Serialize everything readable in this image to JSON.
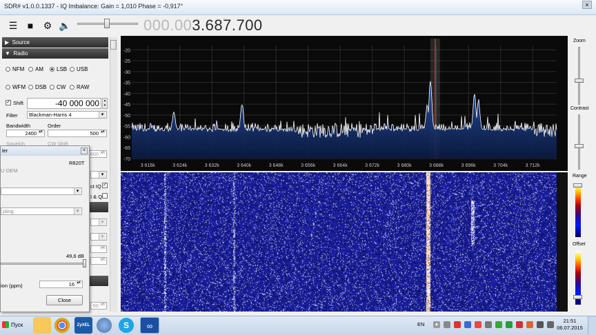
{
  "window": {
    "title": "SDR# v1.0.0.1337 - IQ Imbalance: Gain = 1,010 Phase = -0,917°",
    "close_label": "×"
  },
  "toolbar": {
    "icons": [
      "menu-icon",
      "stop-icon",
      "gear-icon",
      "speaker-icon"
    ],
    "volume_level": 0.45,
    "frequency_dim": "000.00",
    "frequency_main": "3.687.700"
  },
  "panel": {
    "source_header": "Source",
    "radio_header": "Radio",
    "modes_row1": [
      "NFM",
      "AM",
      "LSB",
      "USB"
    ],
    "modes_row2": [
      "WFM",
      "DSB",
      "CW",
      "RAW"
    ],
    "selected_mode": "LSB",
    "shift_label": "Shift",
    "shift_value": "-40 000 000",
    "filter_label": "Filter",
    "filter_value": "Blackman-Harris 4",
    "bandwidth_label": "Bandwidth",
    "order_label": "Order",
    "bandwidth_value": "2400",
    "order_value": "500",
    "squelch_label": "Squelch",
    "cw_shift_label": "CW Shift",
    "cw_value": "600",
    "direct_iq_label": "ct IQ",
    "swap_iq_label": "I & Q",
    "value_50": "-50"
  },
  "dialog": {
    "title": "ler",
    "tuner": "R820T",
    "device_label": "U OEM",
    "sampling_label": "pling",
    "gain_value": "49,6 dB",
    "ppm_label": "ion (ppm)",
    "ppm_value": "16",
    "close_button": "Close",
    "gain_level": 0.98
  },
  "side": {
    "zoom_label": "Zoom",
    "contrast_label": "Contrast",
    "range_label": "Range",
    "offset_label": "Offset"
  },
  "chart_data": {
    "type": "line",
    "title": "",
    "xlabel": "",
    "ylabel": "",
    "x_ticks": [
      "3 616k",
      "3 624k",
      "3 632k",
      "3 640k",
      "3 648k",
      "3 656k",
      "3 664k",
      "3 672k",
      "3 680k",
      "3 688k",
      "3 696k",
      "3 704k",
      "3 712k"
    ],
    "y_ticks": [
      "-20",
      "-25",
      "-30",
      "-35",
      "-40",
      "-45",
      "-50",
      "-55",
      "-60",
      "-65",
      "-70"
    ],
    "xlim": [
      3612,
      3718
    ],
    "ylim": [
      -70,
      -18
    ],
    "noise_floor": -57,
    "peaks": [
      {
        "x": 3622.5,
        "y": -49
      },
      {
        "x": 3639.5,
        "y": -45
      },
      {
        "x": 3686.5,
        "y": -34
      },
      {
        "x": 3685.7,
        "y": -46
      },
      {
        "x": 3697.5,
        "y": -40
      },
      {
        "x": 3698.5,
        "y": -43
      }
    ],
    "tuned_marker_x": 3687.7,
    "colors": {
      "trace": "#ffffff",
      "fill": "#1a3a78",
      "marker": "#b04030"
    }
  },
  "taskbar": {
    "start_label": "Пуск",
    "apps": [
      "folder-icon",
      "chrome-icon",
      "zyxel-icon",
      "network-icon",
      "skype-icon",
      "sdr-icon"
    ],
    "zyxel_label": "ZyXEL",
    "lang": "EN",
    "time": "21:51",
    "date": "06.07.2015"
  }
}
